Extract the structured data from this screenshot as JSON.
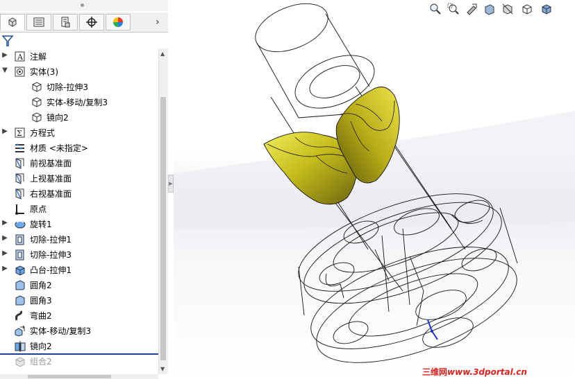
{
  "tree": {
    "items": [
      {
        "label": "注解",
        "icon": "annotation-icon",
        "expand": "▶"
      },
      {
        "label": "实体(3)",
        "icon": "solid-bodies-icon",
        "expand": "▼"
      },
      {
        "label": "切除-拉伸3",
        "icon": "body-icon",
        "expand": ""
      },
      {
        "label": "实体-移动/复制3",
        "icon": "body-icon",
        "expand": ""
      },
      {
        "label": "镜向2",
        "icon": "body-icon",
        "expand": ""
      },
      {
        "label": "方程式",
        "icon": "equation-icon",
        "expand": "▶"
      },
      {
        "label": "材质 <未指定>",
        "icon": "material-icon",
        "expand": ""
      },
      {
        "label": "前视基准面",
        "icon": "plane-icon",
        "expand": ""
      },
      {
        "label": "上视基准面",
        "icon": "plane-icon",
        "expand": ""
      },
      {
        "label": "右视基准面",
        "icon": "plane-icon",
        "expand": ""
      },
      {
        "label": "原点",
        "icon": "origin-icon",
        "expand": ""
      },
      {
        "label": "旋转1",
        "icon": "revolve-icon",
        "expand": "▶"
      },
      {
        "label": "切除-拉伸1",
        "icon": "cut-extrude-icon",
        "expand": "▶"
      },
      {
        "label": "切除-拉伸3",
        "icon": "cut-extrude-icon",
        "expand": "▶"
      },
      {
        "label": "凸台-拉伸1",
        "icon": "boss-extrude-icon",
        "expand": "▶"
      },
      {
        "label": "圆角2",
        "icon": "fillet-icon",
        "expand": ""
      },
      {
        "label": "圆角3",
        "icon": "fillet-icon",
        "expand": ""
      },
      {
        "label": "弯曲2",
        "icon": "flex-icon",
        "expand": ""
      },
      {
        "label": "实体-移动/复制3",
        "icon": "move-copy-icon",
        "expand": ""
      },
      {
        "label": "镜向2",
        "icon": "mirror-icon",
        "expand": ""
      },
      {
        "label": "组合2",
        "icon": "combine-icon",
        "expand": ""
      }
    ]
  },
  "tabs": [
    "feature-manager",
    "property-manager",
    "configuration-manager",
    "dim-xpert",
    "display-manager"
  ],
  "watermark": {
    "cn": "三维网",
    "url": "www.3dportal.cn"
  },
  "colors": {
    "accent": "#1c3fa0",
    "solid": "#c8c21e",
    "watermark": "#e0201b"
  }
}
